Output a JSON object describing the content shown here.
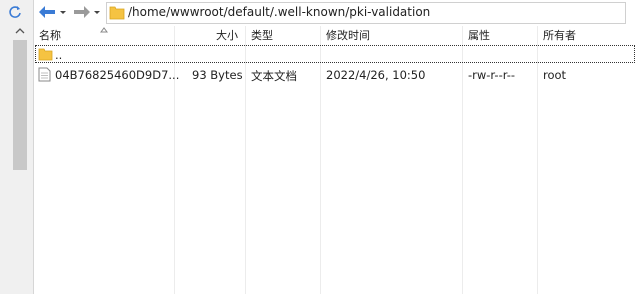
{
  "toolbar": {
    "address": "/home/wwwroot/default/.well-known/pki-validation"
  },
  "icons": {
    "refresh": "refresh-icon",
    "back": "arrow-left-icon",
    "forward": "arrow-right-icon",
    "folder": "folder-icon",
    "file": "text-file-icon"
  },
  "columns": {
    "name": "名称",
    "size": "大小",
    "type": "类型",
    "modified": "修改时间",
    "permissions": "属性",
    "owner": "所有者"
  },
  "rows": [
    {
      "name": "..",
      "size": "",
      "type": "",
      "modified": "",
      "permissions": "",
      "owner": ""
    },
    {
      "name": "04B76825460D9D7...",
      "size": "93 Bytes",
      "type": "文本文档",
      "modified": "2022/4/26, 10:50",
      "permissions": "-rw-r--r--",
      "owner": "root"
    }
  ],
  "colors": {
    "folder": "#f5c342",
    "accent": "#3a7bd5"
  }
}
